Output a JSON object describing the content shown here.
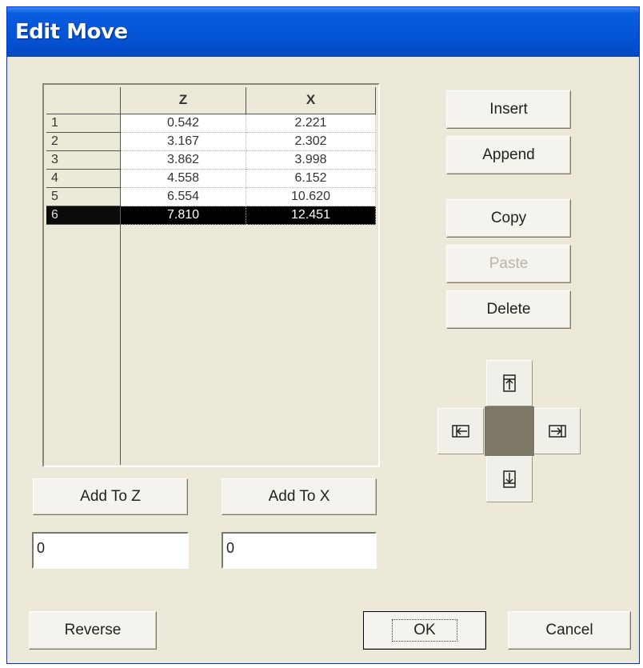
{
  "window": {
    "title": "Edit Move"
  },
  "table": {
    "columns": [
      "Z",
      "X"
    ],
    "rows": [
      {
        "n": "1",
        "z": "0.542",
        "x": "2.221"
      },
      {
        "n": "2",
        "z": "3.167",
        "x": "2.302"
      },
      {
        "n": "3",
        "z": "3.862",
        "x": "3.998"
      },
      {
        "n": "4",
        "z": "4.558",
        "x": "6.152"
      },
      {
        "n": "5",
        "z": "6.554",
        "x": "10.620"
      },
      {
        "n": "6",
        "z": "7.810",
        "x": "12.451"
      }
    ],
    "selected_row": "6"
  },
  "buttons": {
    "insert": "Insert",
    "append": "Append",
    "copy": "Copy",
    "paste": "Paste",
    "delete": "Delete",
    "add_to_z": "Add To Z",
    "add_to_x": "Add To X",
    "reverse": "Reverse",
    "ok": "OK",
    "cancel": "Cancel"
  },
  "inputs": {
    "z_offset": "0",
    "x_offset": "0"
  },
  "move_pad": {
    "icons": [
      "move-up-icon",
      "move-left-icon",
      "move-right-icon",
      "move-down-icon"
    ]
  },
  "colors": {
    "selection": "#000000",
    "dialog_bg": "#ece9d8",
    "titlebar": "#0456d6"
  }
}
